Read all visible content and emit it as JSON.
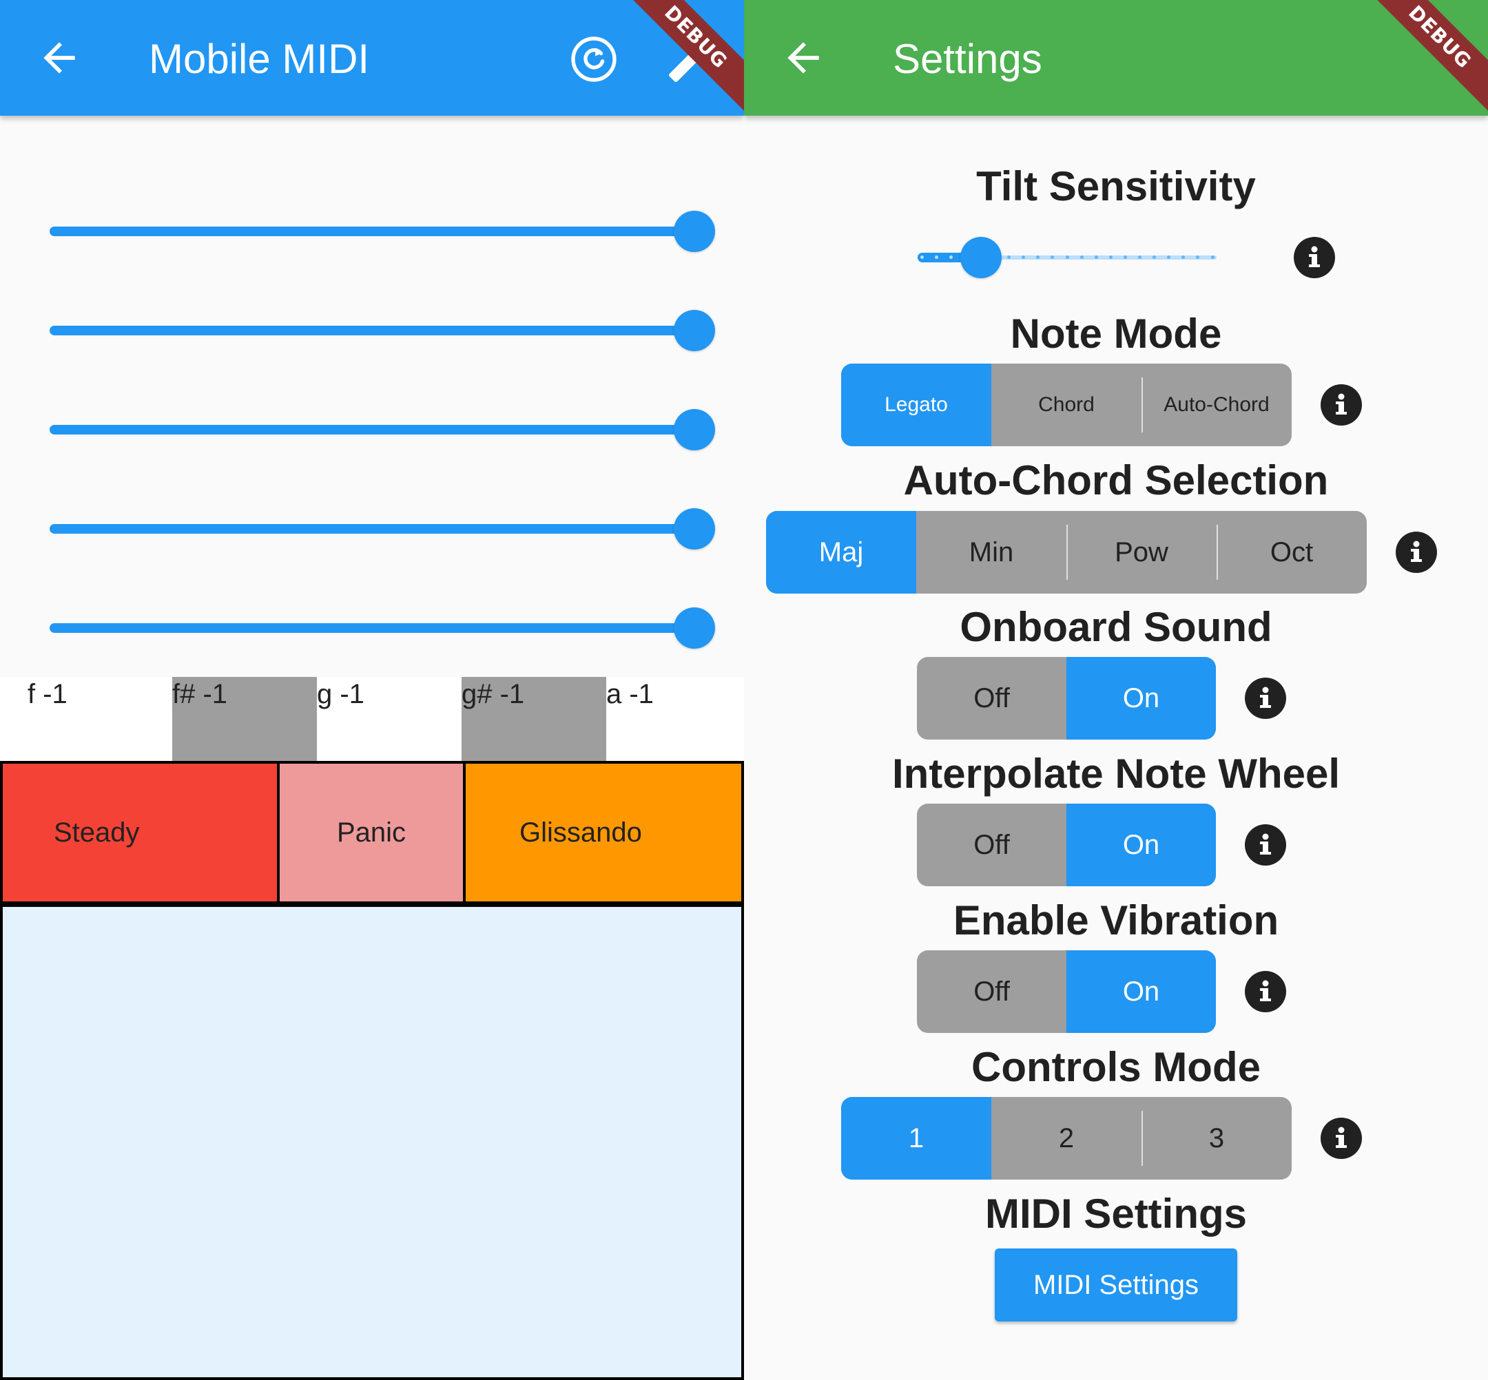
{
  "colors": {
    "primary": "#2196f3",
    "settings_bar": "#4caf50",
    "steady": "#f44336",
    "panic": "#ef9a9a",
    "glissando": "#ff9800",
    "pad": "#e3f2fd",
    "debug_banner": "#8e2f2f"
  },
  "debug_banner": "DEBUG",
  "main": {
    "title": "Mobile MIDI",
    "back_icon": "arrow-back-icon",
    "actions": [
      "refresh-icon",
      "wrench-icon"
    ],
    "sliders": [
      1,
      1,
      1,
      1,
      1
    ],
    "keys": [
      "f -1",
      "f# -1",
      "g -1",
      "g# -1",
      "a -1"
    ],
    "modes": [
      "Steady",
      "Panic",
      "Glissando"
    ]
  },
  "settings": {
    "title": "Settings",
    "tilt": {
      "label": "Tilt Sensitivity",
      "value": 3,
      "max": 20
    },
    "note_mode": {
      "label": "Note Mode",
      "options": [
        "Legato",
        "Chord",
        "Auto-Chord"
      ],
      "selected": "Legato"
    },
    "auto_chord": {
      "label": "Auto-Chord Selection",
      "options": [
        "Maj",
        "Min",
        "Pow",
        "Oct"
      ],
      "selected": "Maj"
    },
    "onboard_sound": {
      "label": "Onboard Sound",
      "options": [
        "Off",
        "On"
      ],
      "selected": "On"
    },
    "interpolate": {
      "label": "Interpolate Note Wheel",
      "options": [
        "Off",
        "On"
      ],
      "selected": "On"
    },
    "vibration": {
      "label": "Enable Vibration",
      "options": [
        "Off",
        "On"
      ],
      "selected": "On"
    },
    "controls_mode": {
      "label": "Controls Mode",
      "options": [
        "1",
        "2",
        "3"
      ],
      "selected": "1"
    },
    "midi": {
      "label": "MIDI Settings",
      "button": "MIDI Settings"
    }
  }
}
